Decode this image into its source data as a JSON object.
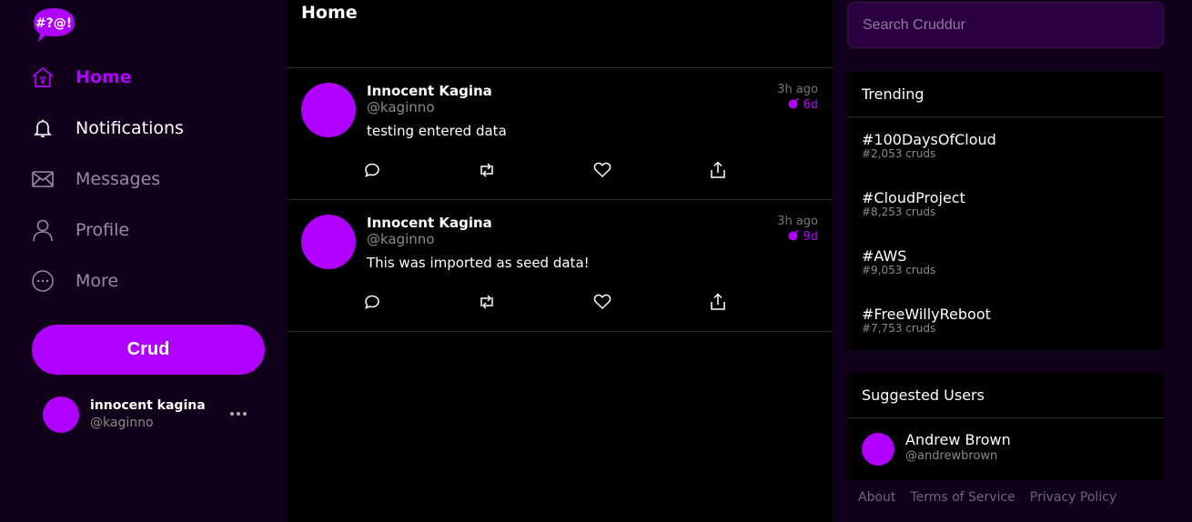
{
  "app": {
    "logo_text": "#?@!"
  },
  "nav": [
    {
      "id": "home",
      "label": "Home",
      "icon": "home-icon",
      "active": true
    },
    {
      "id": "notifications",
      "label": "Notifications",
      "icon": "bell-icon",
      "active": false
    },
    {
      "id": "messages",
      "label": "Messages",
      "icon": "mail-icon",
      "active": false
    },
    {
      "id": "profile",
      "label": "Profile",
      "icon": "user-icon",
      "active": false
    },
    {
      "id": "more",
      "label": "More",
      "icon": "more-circle-icon",
      "active": false
    }
  ],
  "crud_button": {
    "label": "Crud"
  },
  "current_user": {
    "name": "innocent kagina",
    "handle": "@kaginno"
  },
  "feed": {
    "title": "Home",
    "posts": [
      {
        "name": "Innocent Kagina",
        "handle": "@kaginno",
        "message": "testing entered data",
        "time_ago": "3h ago",
        "expires": "6d"
      },
      {
        "name": "Innocent Kagina",
        "handle": "@kaginno",
        "message": "This was imported as seed data!",
        "time_ago": "3h ago",
        "expires": "9d"
      }
    ]
  },
  "search": {
    "placeholder": "Search Cruddur"
  },
  "trending": {
    "title": "Trending",
    "items": [
      {
        "tag": "#100DaysOfCloud",
        "count": "#2,053 cruds"
      },
      {
        "tag": "#CloudProject",
        "count": "#8,253 cruds"
      },
      {
        "tag": "#AWS",
        "count": "#9,053 cruds"
      },
      {
        "tag": "#FreeWillyReboot",
        "count": "#7,753 cruds"
      }
    ]
  },
  "suggested": {
    "title": "Suggested Users",
    "users": [
      {
        "name": "Andrew Brown",
        "handle": "@andrewbrown"
      }
    ]
  },
  "footer": {
    "about": "About",
    "terms": "Terms of Service",
    "privacy": "Privacy Policy"
  },
  "colors": {
    "accent": "#b000ff",
    "sidebar_bg": "#11001a",
    "feed_bg": "#000000"
  }
}
